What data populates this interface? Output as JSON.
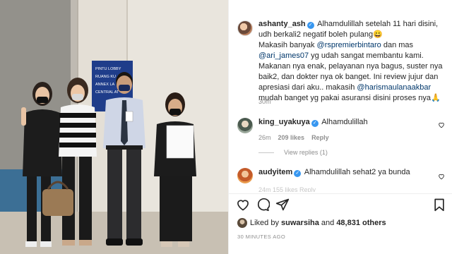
{
  "post": {
    "photo_sign": {
      "line1": "PINTU LOBBY",
      "line2": "RUANG KU",
      "line3": "ANNEX LA",
      "line4": "CENTRAL AT"
    },
    "author": "ashanty_ash",
    "caption_intro": "Alhamdulillah setelah 11 hari disini, udh berkali2 negatif boleh pulang😀",
    "caption_p1": "Makasih banyak ",
    "mention_1": "@rspremierbintaro",
    "caption_p2": " dan mas ",
    "mention_2": "@ari_james07",
    "caption_p3": " yg udah sangat membantu kami. Makanan nya enak, pelayanan nya bagus, suster nya baik2, dan dokter nya ok banget. Ini review jujur dan apresiasi dari aku..",
    "caption_p4": "makasih ",
    "mention_3": "@harismaulanaakbar",
    "caption_p5": " mudah banget yg pakai asuransi disini proses nya🙏",
    "caption_age": "30m"
  },
  "comments": [
    {
      "user": "king_uyakuya",
      "text": "Alhamdulillah",
      "age": "26m",
      "likes": "209 likes",
      "reply": "Reply",
      "view_replies": "View replies (1)"
    },
    {
      "user": "audyitem",
      "text": "Alhamdulillah sehat2 ya bunda",
      "faded_meta": "24m   155 likes   Reply"
    }
  ],
  "actions": {
    "like_icon": "heart-icon",
    "comment_icon": "comment-icon",
    "share_icon": "share-icon",
    "save_icon": "bookmark-icon"
  },
  "likes": {
    "prefix": "Liked by ",
    "user": "suwarsiha",
    "middle": " and ",
    "count": "48,831 others"
  },
  "timestamp": "30 MINUTES AGO",
  "colors": {
    "link": "#00376b",
    "verified": "#3897f0",
    "muted": "#8e8e8e"
  }
}
